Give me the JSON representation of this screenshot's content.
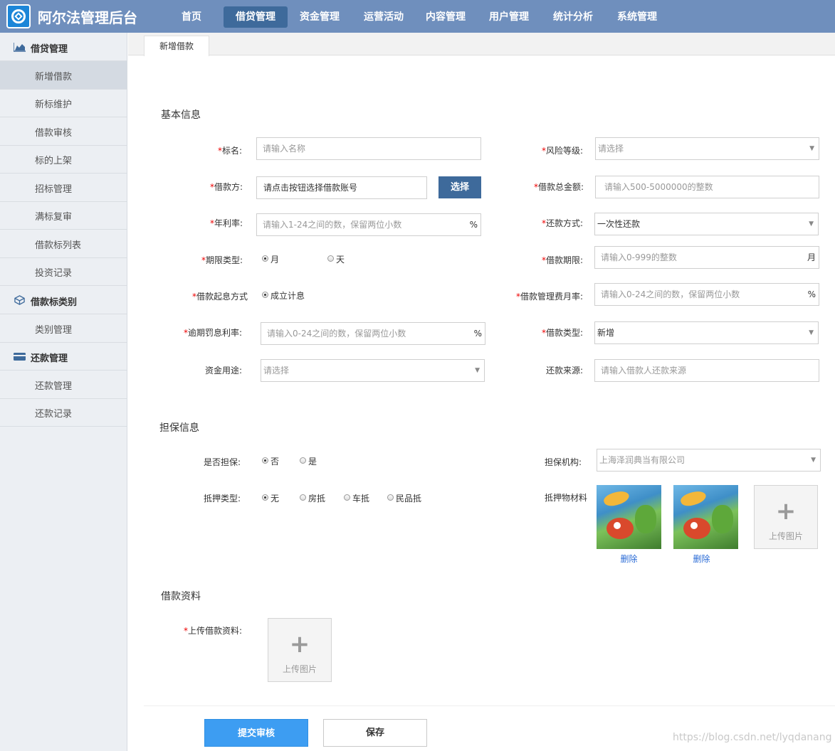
{
  "header": {
    "title": "阿尔法管理后台",
    "nav": [
      "首页",
      "借贷管理",
      "资金管理",
      "运营活动",
      "内容管理",
      "用户管理",
      "统计分析",
      "系统管理"
    ],
    "active_nav": "借贷管理"
  },
  "sidebar": {
    "groups": [
      {
        "label": "借贷管理",
        "icon": "area-chart-icon",
        "items": [
          "新增借款",
          "新标维护",
          "借款审核",
          "标的上架",
          "招标管理",
          "满标复审",
          "借款标列表",
          "投资记录"
        ]
      },
      {
        "label": "借款标类别",
        "icon": "cube-icon",
        "items": [
          "类别管理"
        ]
      },
      {
        "label": "还款管理",
        "icon": "card-icon",
        "items": [
          "还款管理",
          "还款记录"
        ]
      }
    ],
    "active_item": "新增借款"
  },
  "tabs": {
    "active": "新增借款"
  },
  "basic": {
    "title": "基本信息",
    "name_label": "标名:",
    "name_placeholder": "请输入名称",
    "risk_label": "风险等级:",
    "risk_value": "请选择",
    "borrower_label": "借款方:",
    "borrower_value": "请点击按钮选择借款账号",
    "choose_btn": "选择",
    "total_label": "借款总金额:",
    "total_placeholder": "请输入500-5000000的整数",
    "rate_label": "年利率:",
    "rate_placeholder": "请输入1-24之间的数，保留两位小数",
    "rate_suffix": "%",
    "repay_label": "还款方式:",
    "repay_value": "一次性还款",
    "term_type_label": "期限类型:",
    "term_type_month": "月",
    "term_type_day": "天",
    "term_label": "借款期限:",
    "term_placeholder": "请输入0-999的整数",
    "term_suffix": "月",
    "interest_start_label": "借款起息方式",
    "interest_start_option": "成立计息",
    "fee_label": "借款管理费月率:",
    "fee_placeholder": "请输入0-24之间的数，保留两位小数",
    "fee_suffix": "%",
    "overdue_label": "逾期罚息利率:",
    "overdue_placeholder": "请输入0-24之间的数，保留两位小数",
    "overdue_suffix": "%",
    "loan_type_label": "借款类型:",
    "loan_type_value": "新增",
    "purpose_label": "资金用途:",
    "purpose_value": "请选择",
    "source_label": "还款来源:",
    "source_placeholder": "请输入借款人还款来源"
  },
  "guarantee": {
    "title": "担保信息",
    "is_guarantee_label": "是否担保:",
    "opt_no": "否",
    "opt_yes": "是",
    "org_label": "担保机构:",
    "org_value": "上海泽润典当有限公司",
    "mortgage_label": "抵押类型:",
    "mortgage_options": [
      "无",
      "房抵",
      "车抵",
      "民品抵"
    ],
    "material_label": "抵押物材料",
    "delete_label": "删除",
    "upload_label": "上传图片",
    "plus": "+"
  },
  "materials": {
    "title": "借款资料",
    "upload_label": "上传借款资料:",
    "upload_text": "上传图片",
    "plus": "+"
  },
  "actions": {
    "submit": "提交审核",
    "save": "保存"
  },
  "watermark": "https://blog.csdn.net/lyqdanang",
  "required_mark": "*",
  "colors": {
    "topbar": "#6f8fbd",
    "active_nav": "#3e6a9b",
    "submit": "#3d9df2",
    "link": "#2a6bd6"
  }
}
